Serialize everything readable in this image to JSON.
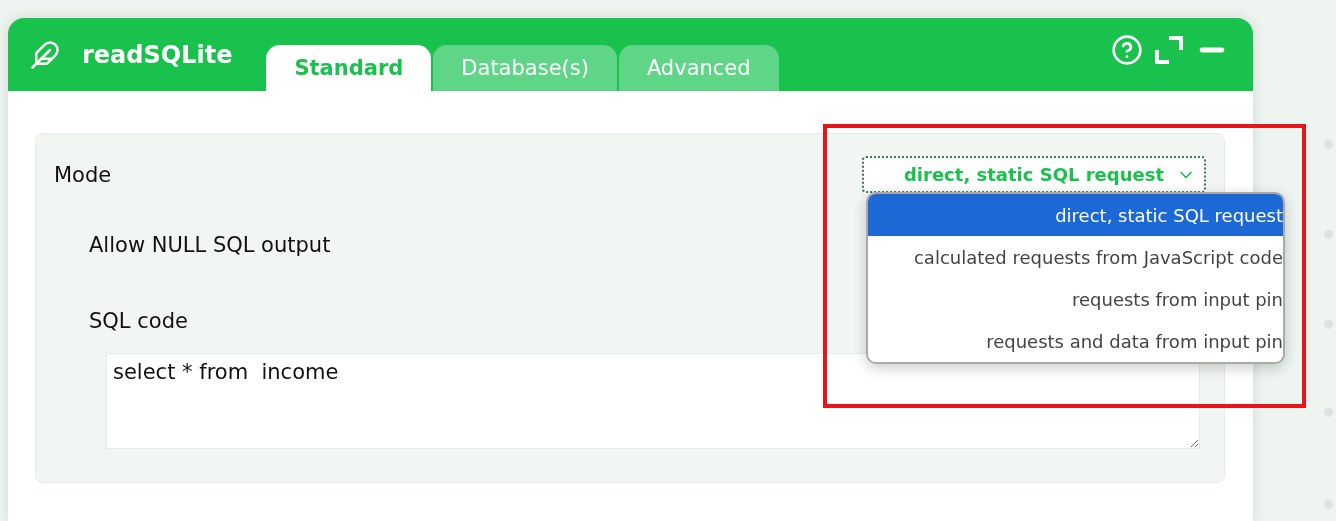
{
  "window": {
    "title": "readSQLite"
  },
  "tabs": [
    {
      "label": "Standard",
      "selected": true
    },
    {
      "label": "Database(s)",
      "selected": false
    },
    {
      "label": "Advanced",
      "selected": false
    }
  ],
  "mode": {
    "label": "Mode",
    "value": "direct, static SQL request",
    "expanded": true,
    "options": [
      {
        "label": "direct, static SQL request",
        "selected": true
      },
      {
        "label": "calculated requests from JavaScript code",
        "selected": false
      },
      {
        "label": "requests from input pin",
        "selected": false
      },
      {
        "label": "requests and data from input pin",
        "selected": false
      }
    ]
  },
  "allow_null": {
    "label": "Allow NULL SQL output"
  },
  "sql": {
    "label": "SQL code",
    "value": "select * from  income"
  },
  "annotation": {
    "kind": "highlight"
  }
}
